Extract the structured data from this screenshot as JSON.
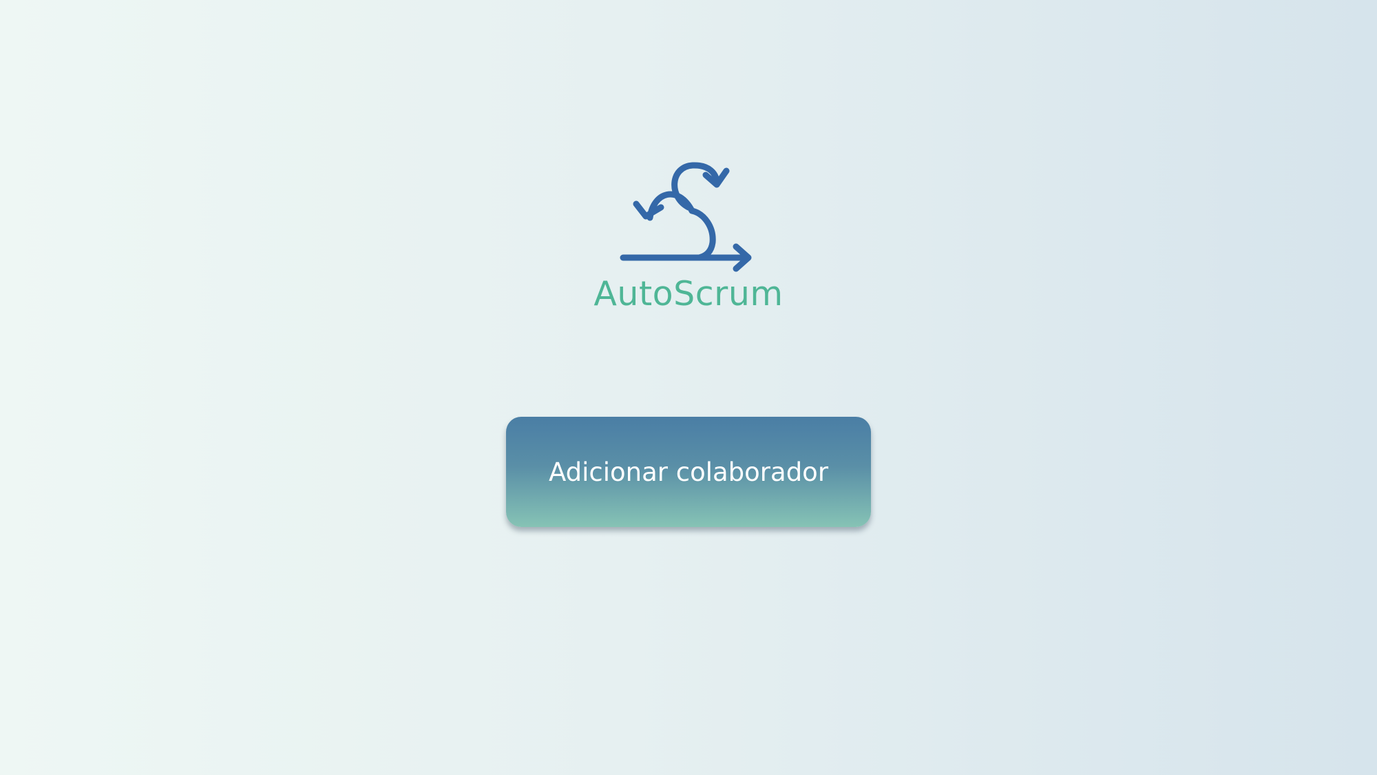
{
  "app": {
    "logo_icon": "scrum-sprint-cycle-icon",
    "brand_name": "AutoScrum"
  },
  "main": {
    "add_collaborator_label": "Adicionar colaborador"
  },
  "colors": {
    "icon": "#3468a8",
    "brand_text": "#4fb696",
    "button_top": "#4a7ea5",
    "button_bottom": "#86c3b5",
    "button_text": "#ffffff"
  }
}
